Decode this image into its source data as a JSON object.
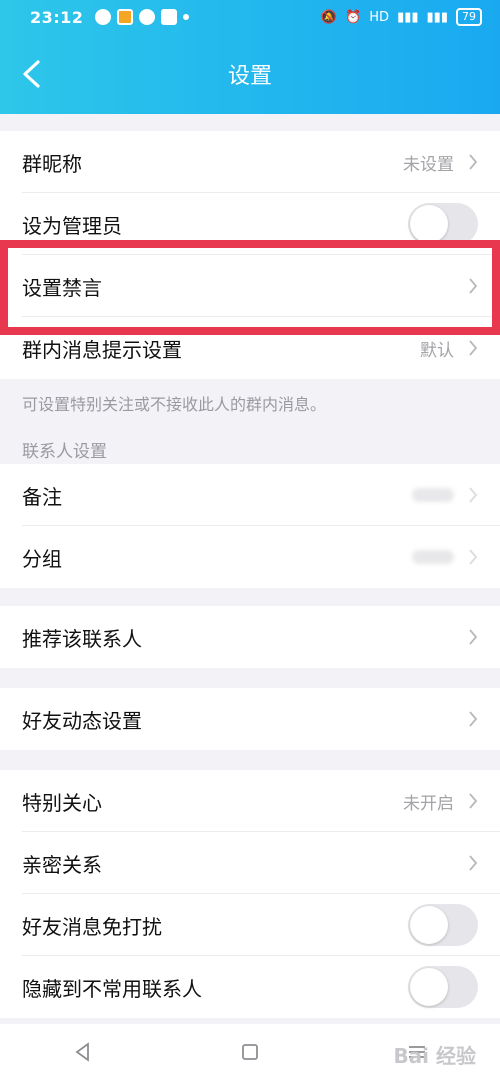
{
  "status": {
    "time": "23:12",
    "network": "HD",
    "battery": "79"
  },
  "nav": {
    "title": "设置"
  },
  "rows_group1": [
    {
      "label": "群昵称",
      "value": "未设置"
    },
    {
      "label": "设为管理员"
    },
    {
      "label": "设置禁言"
    },
    {
      "label": "群内消息提示设置",
      "value": "默认"
    }
  ],
  "hint": "可设置特别关注或不接收此人的群内消息。",
  "section_contact": "联系人设置",
  "rows_group2": [
    {
      "label": "备注"
    },
    {
      "label": "分组"
    }
  ],
  "row_recommend": {
    "label": "推荐该联系人"
  },
  "row_feed": {
    "label": "好友动态设置"
  },
  "rows_group3": [
    {
      "label": "特别关心",
      "value": "未开启"
    },
    {
      "label": "亲密关系"
    },
    {
      "label": "好友消息免打扰"
    },
    {
      "label": "隐藏到不常用联系人"
    }
  ],
  "watermark": "Bai 经验"
}
